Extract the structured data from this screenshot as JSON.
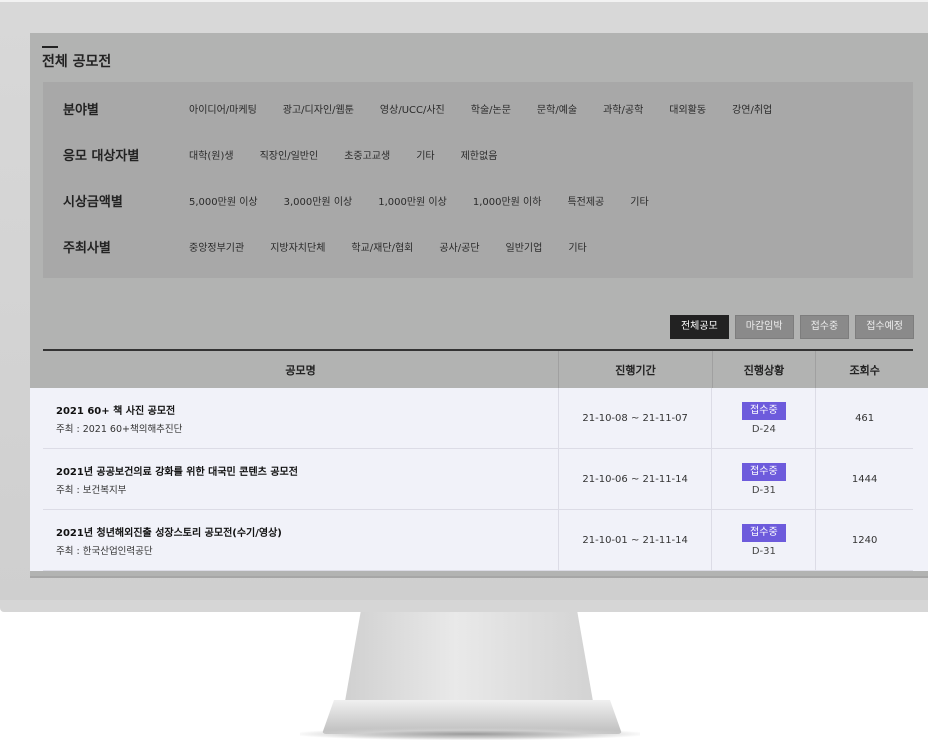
{
  "page": {
    "title": "전체 공모전"
  },
  "filters": [
    {
      "label": "분야별",
      "items": [
        "아이디어/마케팅",
        "광고/디자인/웹툰",
        "영상/UCC/사진",
        "학술/논문",
        "문학/예술",
        "과학/공학",
        "대외활동",
        "강연/취업"
      ]
    },
    {
      "label": "응모 대상자별",
      "items": [
        "대학(원)생",
        "직장인/일반인",
        "초중고교생",
        "기타",
        "제한없음"
      ]
    },
    {
      "label": "시상금액별",
      "items": [
        "5,000만원 이상",
        "3,000만원 이상",
        "1,000만원 이상",
        "1,000만원 이하",
        "특전제공",
        "기타"
      ]
    },
    {
      "label": "주최사별",
      "items": [
        "중앙정부기관",
        "지방자치단체",
        "학교/재단/협회",
        "공사/공단",
        "일반기업",
        "기타"
      ]
    }
  ],
  "tabs": [
    "전체공모",
    "마감임박",
    "접수중",
    "접수예정"
  ],
  "table": {
    "headers": [
      "공모명",
      "진행기간",
      "진행상황",
      "조회수"
    ],
    "rows": [
      {
        "title": "2021 60+ 책 사진 공모전",
        "organizer": "주최 : 2021 60+책의해추진단",
        "period": "21-10-08 ~ 21-11-07",
        "status": "접수중",
        "dday": "D-24",
        "views": "461"
      },
      {
        "title": "2021년 공공보건의료 강화를 위한 대국민 콘텐츠 공모전",
        "organizer": "주최 : 보건복지부",
        "period": "21-10-06 ~ 21-11-14",
        "status": "접수중",
        "dday": "D-31",
        "views": "1444"
      },
      {
        "title": "2021년 청년해외진출 성장스토리 공모전(수기/영상)",
        "organizer": "주최 : 한국산업인력공단",
        "period": "21-10-01 ~ 21-11-14",
        "status": "접수중",
        "dday": "D-31",
        "views": "1240"
      }
    ]
  },
  "colors": {
    "badge": "#6d5bdc",
    "active_tab": "#222222",
    "row_bg": "#f1f2f9"
  }
}
